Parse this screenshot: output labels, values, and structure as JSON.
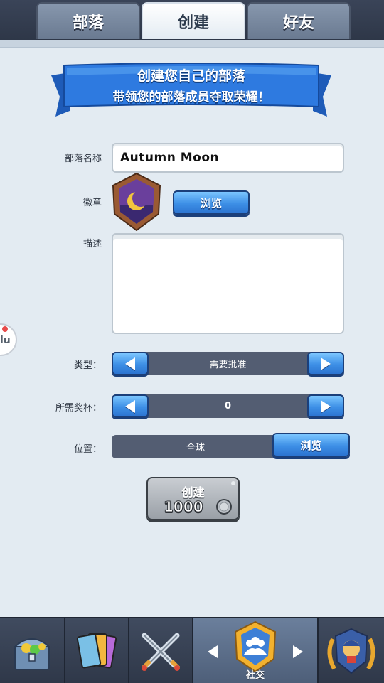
{
  "tabs": [
    {
      "label": "部落"
    },
    {
      "label": "创建"
    },
    {
      "label": "好友"
    }
  ],
  "banner": {
    "title": "创建您自己的部落",
    "subtitle": "带领您的部落成员夺取荣耀！"
  },
  "form": {
    "name_label": "部落名称",
    "name_value": "Autumn Moon",
    "badge_label": "徽章",
    "badge_browse": "浏览",
    "desc_label": "描述",
    "desc_value": "",
    "type_label": "类型：",
    "type_value": "需要批准",
    "trophies_label": "所需奖杯：",
    "trophies_value": "0",
    "location_label": "位置：",
    "location_value": "全球",
    "location_browse": "浏览"
  },
  "create": {
    "label": "创建",
    "cost": "1000"
  },
  "side_bubble": {
    "text": "lu"
  },
  "bottom_nav": {
    "social_label": "社交"
  },
  "colors": {
    "accent_blue": "#3d8fe6",
    "bg": "#e3ebf2",
    "selector_bg": "#535d72"
  }
}
